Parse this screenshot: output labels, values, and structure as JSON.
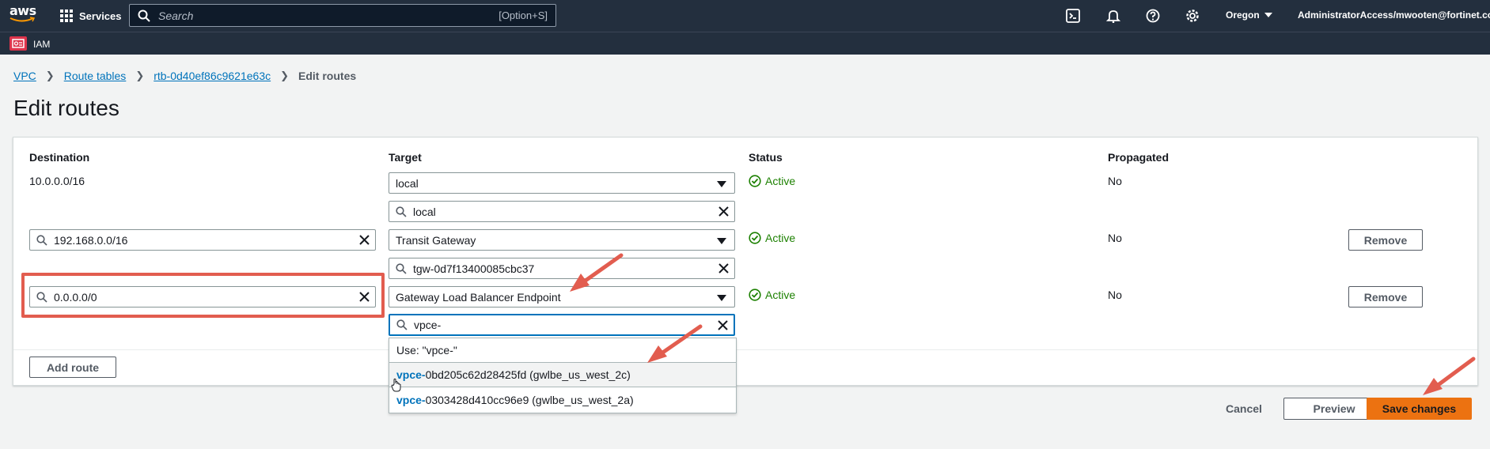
{
  "topnav": {
    "logo_text": "aws",
    "services_label": "Services",
    "search_placeholder": "Search",
    "search_shortcut": "[Option+S]",
    "region": "Oregon",
    "account": "AdministratorAccess/mwooten@fortinet.com"
  },
  "subnav": {
    "service": "IAM"
  },
  "breadcrumb": [
    {
      "label": "VPC"
    },
    {
      "label": "Route tables"
    },
    {
      "label": "rtb-0d40ef86c9621e63c"
    },
    {
      "label": "Edit routes"
    }
  ],
  "page_title": "Edit routes",
  "columns": {
    "destination": "Destination",
    "target": "Target",
    "status": "Status",
    "propagated": "Propagated"
  },
  "routes": [
    {
      "destination": "10.0.0.0/16",
      "target_type": "local",
      "target_search": "local",
      "status": "Active",
      "propagated": "No"
    },
    {
      "destination": "192.168.0.0/16",
      "target_type": "Transit Gateway",
      "target_search": "tgw-0d7f13400085cbc37",
      "status": "Active",
      "propagated": "No",
      "remove_label": "Remove"
    },
    {
      "destination": "0.0.0.0/0",
      "target_type": "Gateway Load Balancer Endpoint",
      "target_search": "vpce-",
      "status": "Active",
      "propagated": "No",
      "remove_label": "Remove"
    }
  ],
  "dropdown": {
    "use_option": "Use: \"vpce-\"",
    "options": [
      {
        "match": "vpce-",
        "rest": "0bd205c62d28425fd (gwlbe_us_west_2c)"
      },
      {
        "match": "vpce-",
        "rest": "0303428d410cc96e9 (gwlbe_us_west_2a)"
      }
    ]
  },
  "buttons": {
    "add_route": "Add route",
    "cancel": "Cancel",
    "preview": "Preview",
    "save": "Save changes"
  },
  "colors": {
    "nav_bg": "#232f3e",
    "link": "#0073bb",
    "active": "#1d8102",
    "primary": "#ec7211",
    "annotation": "#e25d4f"
  }
}
